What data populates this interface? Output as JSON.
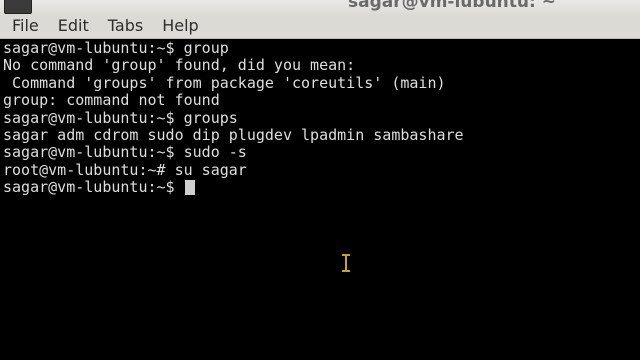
{
  "window": {
    "title": "sagar@vm-lubuntu: ~"
  },
  "menu": {
    "items": [
      "File",
      "Edit",
      "Tabs",
      "Help"
    ]
  },
  "terminal": {
    "lines": [
      "sagar@vm-lubuntu:~$ group",
      "No command 'group' found, did you mean:",
      " Command 'groups' from package 'coreutils' (main)",
      "group: command not found",
      "sagar@vm-lubuntu:~$ groups",
      "sagar adm cdrom sudo dip plugdev lpadmin sambashare",
      "sagar@vm-lubuntu:~$ sudo -s",
      "root@vm-lubuntu:~# su sagar"
    ],
    "current_prompt": "sagar@vm-lubuntu:~$ "
  },
  "icons": {
    "app": "terminal-app-icon",
    "mouse": "text-cursor-ibeam-icon"
  },
  "colors": {
    "background": "#000000",
    "foreground": "#dedede",
    "menubar": "#dcdad5",
    "ibeam": "#c9a227"
  }
}
